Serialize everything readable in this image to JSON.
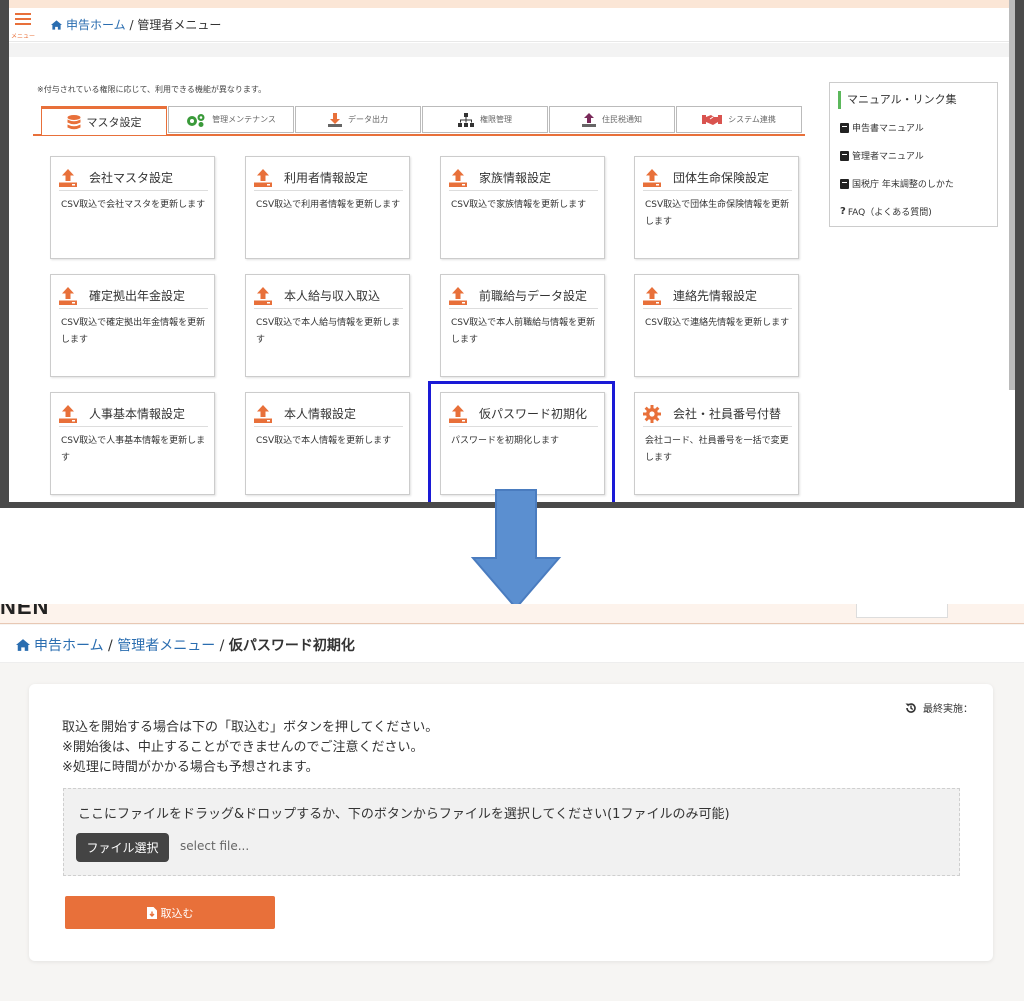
{
  "top": {
    "menu_label": "メニュー",
    "breadcrumb": {
      "home": "申告ホーム",
      "sep": " / ",
      "current": "管理者メニュー"
    },
    "notice": "※付与されている権限に応じて、利用できる機能が異なります。",
    "tabs": [
      {
        "label": "マスタ設定",
        "icon": "database-icon"
      },
      {
        "label": "管理メンテナンス",
        "icon": "gears-icon"
      },
      {
        "label": "データ出力",
        "icon": "download-icon"
      },
      {
        "label": "権限管理",
        "icon": "sitemap-icon"
      },
      {
        "label": "住民税通知",
        "icon": "upload-icon"
      },
      {
        "label": "システム連携",
        "icon": "handshake-icon"
      }
    ],
    "cards": [
      {
        "title": "会社マスタ設定",
        "desc": "CSV取込で会社マスタを更新します",
        "icon": "upload-icon"
      },
      {
        "title": "利用者情報設定",
        "desc": "CSV取込で利用者情報を更新します",
        "icon": "upload-icon"
      },
      {
        "title": "家族情報設定",
        "desc": "CSV取込で家族情報を更新します",
        "icon": "upload-icon"
      },
      {
        "title": "団体生命保険設定",
        "desc": "CSV取込で団体生命保険情報を更新します",
        "icon": "upload-icon"
      },
      {
        "title": "確定拠出年金設定",
        "desc": "CSV取込で確定拠出年金情報を更新します",
        "icon": "upload-icon"
      },
      {
        "title": "本人給与収入取込",
        "desc": "CSV取込で本人給与情報を更新します",
        "icon": "upload-icon"
      },
      {
        "title": "前職給与データ設定",
        "desc": "CSV取込で本人前職給与情報を更新します",
        "icon": "upload-icon"
      },
      {
        "title": "連絡先情報設定",
        "desc": "CSV取込で連絡先情報を更新します",
        "icon": "upload-icon"
      },
      {
        "title": "人事基本情報設定",
        "desc": "CSV取込で人事基本情報を更新します",
        "icon": "upload-icon"
      },
      {
        "title": "本人情報設定",
        "desc": "CSV取込で本人情報を更新します",
        "icon": "upload-icon"
      },
      {
        "title": "仮パスワード初期化",
        "desc": "パスワードを初期化します",
        "icon": "upload-icon"
      },
      {
        "title": "会社・社員番号付替",
        "desc": "会社コード、社員番号を一括で変更します",
        "icon": "gear-icon"
      }
    ],
    "links": {
      "heading": "マニュアル・リンク集",
      "items": [
        {
          "label": "申告書マニュアル",
          "icon": "book-icon"
        },
        {
          "label": "管理者マニュアル",
          "icon": "book-icon"
        },
        {
          "label": "国税庁 年末調整のしかた",
          "icon": "book-icon"
        },
        {
          "label": "FAQ（よくある質問)",
          "icon": "question-icon"
        }
      ]
    }
  },
  "bottom": {
    "breadcrumb": {
      "home": "申告ホーム",
      "sep1": " / ",
      "admin": "管理者メニュー",
      "sep2": " / ",
      "current": "仮パスワード初期化"
    },
    "last_run": "最終実施：",
    "instructions": [
      "取込を開始する場合は下の「取込む」ボタンを押してください。",
      "※開始後は、中止することができませんのでご注意ください。",
      "※処理に時間がかかる場合も予想されます。"
    ],
    "dropzone_text": "ここにファイルをドラッグ&ドロップするか、下のボタンからファイルを選択してください(1ファイルのみ可能)",
    "file_button": "ファイル選択",
    "file_placeholder": "select file...",
    "import_button": "取込む"
  },
  "colors": {
    "accent": "#e8703a",
    "link": "#2a6db0",
    "highlight": "#1a1ad6",
    "arrow": "#5b8fd0"
  }
}
